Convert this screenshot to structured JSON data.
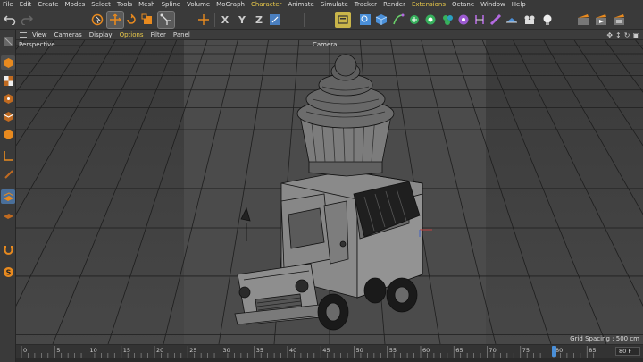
{
  "menu": {
    "items": [
      {
        "label": "File"
      },
      {
        "label": "Edit"
      },
      {
        "label": "Create"
      },
      {
        "label": "Modes"
      },
      {
        "label": "Select"
      },
      {
        "label": "Tools"
      },
      {
        "label": "Mesh"
      },
      {
        "label": "Spline"
      },
      {
        "label": "Volume"
      },
      {
        "label": "MoGraph"
      },
      {
        "label": "Character",
        "accent": true
      },
      {
        "label": "Animate"
      },
      {
        "label": "Simulate"
      },
      {
        "label": "Tracker"
      },
      {
        "label": "Render"
      },
      {
        "label": "Extensions",
        "accent": true
      },
      {
        "label": "Octane"
      },
      {
        "label": "Window"
      },
      {
        "label": "Help"
      }
    ]
  },
  "toolbar": {
    "axis_x": "X",
    "axis_y": "Y",
    "axis_z": "Z"
  },
  "viewport_menu": {
    "items": [
      {
        "label": "View"
      },
      {
        "label": "Cameras"
      },
      {
        "label": "Display"
      },
      {
        "label": "Options",
        "on": true
      },
      {
        "label": "Filter"
      },
      {
        "label": "Panel"
      }
    ]
  },
  "viewport": {
    "view_name": "Perspective",
    "camera_name": "Camera",
    "grid_spacing": "Grid Spacing : 500 cm"
  },
  "timeline": {
    "ticks": [
      "0",
      "5",
      "10",
      "15",
      "20",
      "25",
      "30",
      "35",
      "40",
      "45",
      "50",
      "55",
      "60",
      "65",
      "70",
      "75",
      "80",
      "85"
    ],
    "current_frame": 80,
    "frame_field": "80 F"
  },
  "colors": {
    "accent": "#e8c84a",
    "selection_blue": "#4a8fd8",
    "tool_orange": "#e88a1f"
  }
}
